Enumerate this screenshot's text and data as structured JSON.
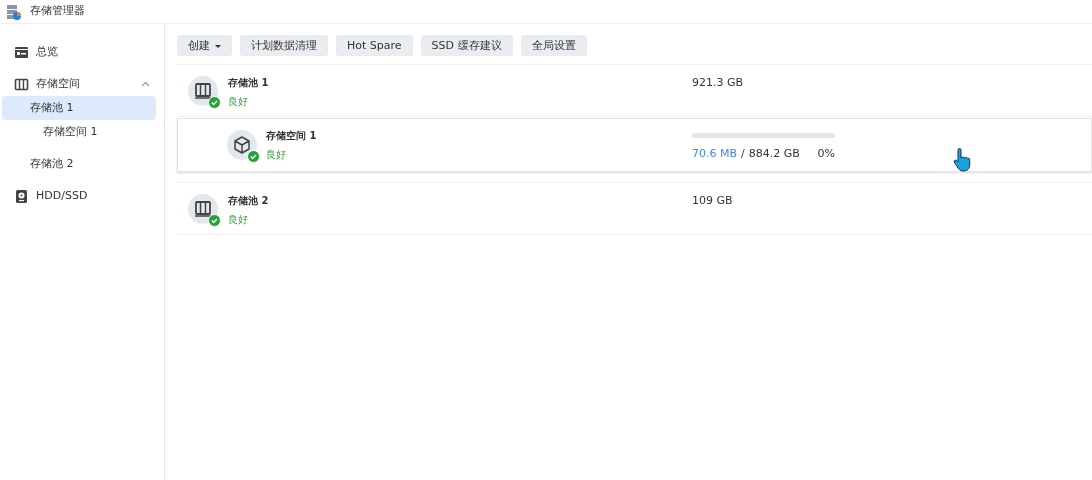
{
  "window": {
    "title": "存储管理器"
  },
  "sidebar": {
    "items": [
      {
        "label": "总览",
        "kind": "overview",
        "selected": false
      },
      {
        "label": "存储空间",
        "kind": "storage",
        "selected": false,
        "expanded": true,
        "children": [
          {
            "label": "存储池 1",
            "selected": true,
            "children": [
              {
                "label": "存储空间 1",
                "selected": false
              }
            ]
          },
          {
            "label": "存储池 2",
            "selected": false
          }
        ]
      },
      {
        "label": "HDD/SSD",
        "kind": "disk",
        "selected": false
      }
    ]
  },
  "toolbar": [
    {
      "label": "创建",
      "dropdown": true
    },
    {
      "label": "计划数据清理",
      "dropdown": false
    },
    {
      "label": "Hot Spare",
      "dropdown": false
    },
    {
      "label": "SSD 缓存建议",
      "dropdown": false
    },
    {
      "label": "全局设置",
      "dropdown": false
    }
  ],
  "pools": [
    {
      "name": "存储池 1",
      "status": "良好",
      "capacity": "921.3 GB",
      "volumes": [
        {
          "name": "存储空间 1",
          "status": "良好",
          "used": "70.6 MB",
          "separator": "/",
          "total": "884.2 GB",
          "percent": "0%",
          "level": 0
        }
      ]
    },
    {
      "name": "存储池 2",
      "status": "良好",
      "capacity": "109 GB"
    }
  ]
}
